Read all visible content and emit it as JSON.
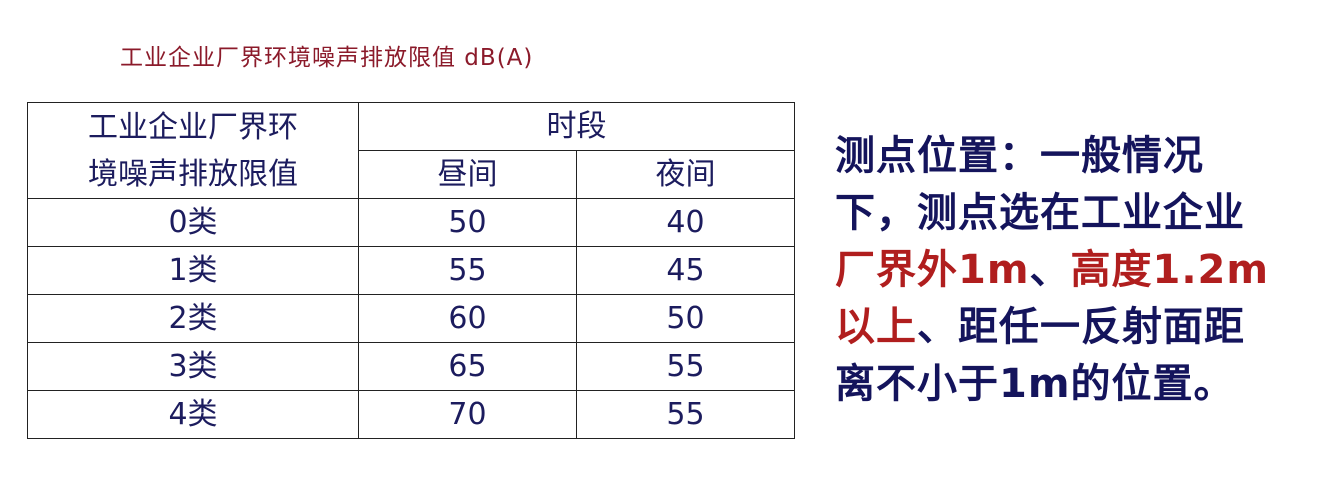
{
  "caption": "工业企业厂界环境噪声排放限值  dB(A)",
  "table": {
    "header_label_line1": "工业企业厂界环",
    "header_label_line2": "境噪声排放限值",
    "period_header": "时段",
    "col_day": "昼间",
    "col_night": "夜间",
    "rows": [
      {
        "category": "0类",
        "day": "50",
        "night": "40"
      },
      {
        "category": "1类",
        "day": "55",
        "night": "45"
      },
      {
        "category": "2类",
        "day": "60",
        "night": "50"
      },
      {
        "category": "3类",
        "day": "65",
        "night": "55"
      },
      {
        "category": "4类",
        "day": "70",
        "night": "55"
      }
    ]
  },
  "description": {
    "part1": "测点位置：一般情况下，测点选在工业企业",
    "highlight1": "厂界外1m",
    "part2": "、",
    "highlight2": "高度1.2m以上",
    "part3": "、距任一反射面距离不小于1m的位置。"
  },
  "colors": {
    "caption": "#8b1a2a",
    "table_text": "#1c1c5e",
    "body_text": "#14145c",
    "highlight": "#b01e1e"
  }
}
